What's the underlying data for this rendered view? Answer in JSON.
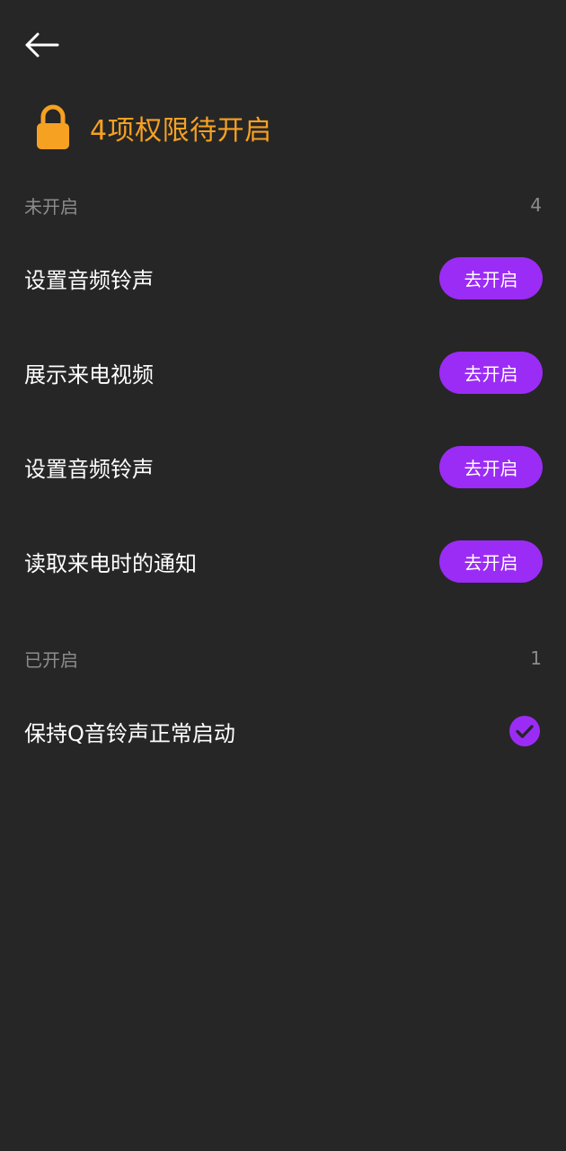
{
  "header": {
    "title": "4项权限待开启",
    "accent_color": "#f7a122",
    "back_icon": "arrow-left-icon",
    "lock_icon": "lock-icon"
  },
  "pending": {
    "label": "未开启",
    "count": "4",
    "button_color": "#9b2cf5",
    "items": [
      {
        "label": "设置音频铃声",
        "button": "去开启"
      },
      {
        "label": "展示来电视频",
        "button": "去开启"
      },
      {
        "label": "设置音频铃声",
        "button": "去开启"
      },
      {
        "label": "读取来电时的通知",
        "button": "去开启"
      }
    ]
  },
  "enabled": {
    "label": "已开启",
    "count": "1",
    "check_icon": "check-circle-icon",
    "items": [
      {
        "label": "保持Q音铃声正常启动"
      }
    ]
  }
}
